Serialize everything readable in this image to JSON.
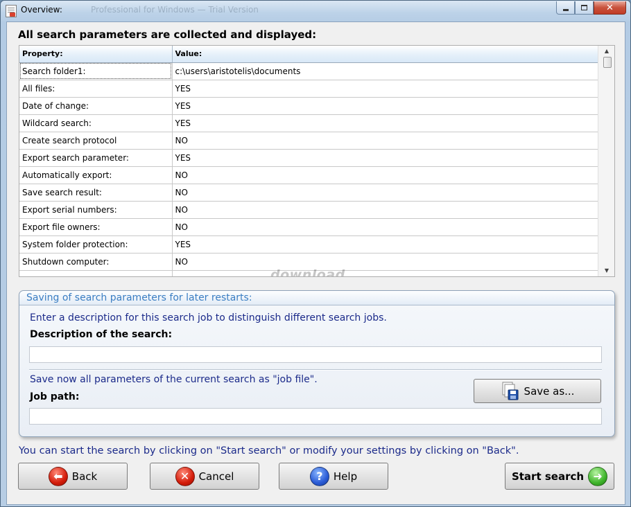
{
  "window": {
    "title": "Overview:",
    "title_ghost": "Professional for Windows — Trial Version"
  },
  "heading": "All search parameters are collected and displayed:",
  "grid": {
    "columns": [
      "Property:",
      "Value:"
    ],
    "rows": [
      {
        "property": "Search folder1:",
        "value": "c:\\users\\aristotelis\\documents"
      },
      {
        "property": "All files:",
        "value": "YES"
      },
      {
        "property": "Date of change:",
        "value": "YES"
      },
      {
        "property": "Wildcard search:",
        "value": "YES"
      },
      {
        "property": "Create search protocol",
        "value": "NO"
      },
      {
        "property": "Export search parameter:",
        "value": "YES"
      },
      {
        "property": "Automatically export:",
        "value": "NO"
      },
      {
        "property": "Save search result:",
        "value": "NO"
      },
      {
        "property": "Export serial numbers:",
        "value": "NO"
      },
      {
        "property": "Export file owners:",
        "value": "NO"
      },
      {
        "property": "System folder protection:",
        "value": "YES"
      },
      {
        "property": "Shutdown computer:",
        "value": "NO"
      },
      {
        "property": "",
        "value": ""
      }
    ]
  },
  "watermark": "download",
  "saving": {
    "title": "Saving of search parameters for later restarts:",
    "description_hint": "Enter a description for this search job to distinguish different search jobs.",
    "description_label": "Description of the search:",
    "description_value": "",
    "job_hint": "Save now all parameters of the current search as \"job file\".",
    "job_label": "Job path:",
    "job_value": "",
    "save_as_label": "Save as..."
  },
  "footer_hint": "You can start the search by clicking on \"Start search\" or modify your settings by clicking on \"Back\".",
  "buttons": {
    "back": "Back",
    "cancel": "Cancel",
    "help": "Help",
    "start": "Start search"
  },
  "icons": {
    "back": "left-arrow-icon",
    "cancel": "cancel-x-icon",
    "help": "question-icon",
    "start": "right-arrow-icon",
    "save_as": "floppy-disk-icon"
  }
}
